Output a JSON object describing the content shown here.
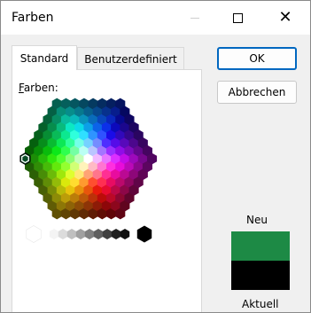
{
  "window": {
    "title": "Farben"
  },
  "titlebar": {
    "min_icon": "minimize-icon",
    "max_icon": "maximize-icon",
    "close_icon": "close-icon",
    "close_glyph": "✕"
  },
  "tabs": [
    {
      "label": "Standard",
      "active": true
    },
    {
      "label": "Benutzerdefiniert",
      "active": false
    }
  ],
  "palette": {
    "label_accel": "F",
    "label_rest": "arben:",
    "selected": "#0a4d27",
    "grays": [
      "#ffffff",
      "#f4f4f4",
      "#dcdcdc",
      "#c0c0c0",
      "#a0a0a0",
      "#808080",
      "#606060",
      "#404040",
      "#202020",
      "#101010",
      "#000000"
    ]
  },
  "buttons": {
    "ok": "OK",
    "cancel": "Abbrechen"
  },
  "preview": {
    "new_label": "Neu",
    "current_label": "Aktuell",
    "new_color": "#1d8a45",
    "current_color": "#000000"
  }
}
